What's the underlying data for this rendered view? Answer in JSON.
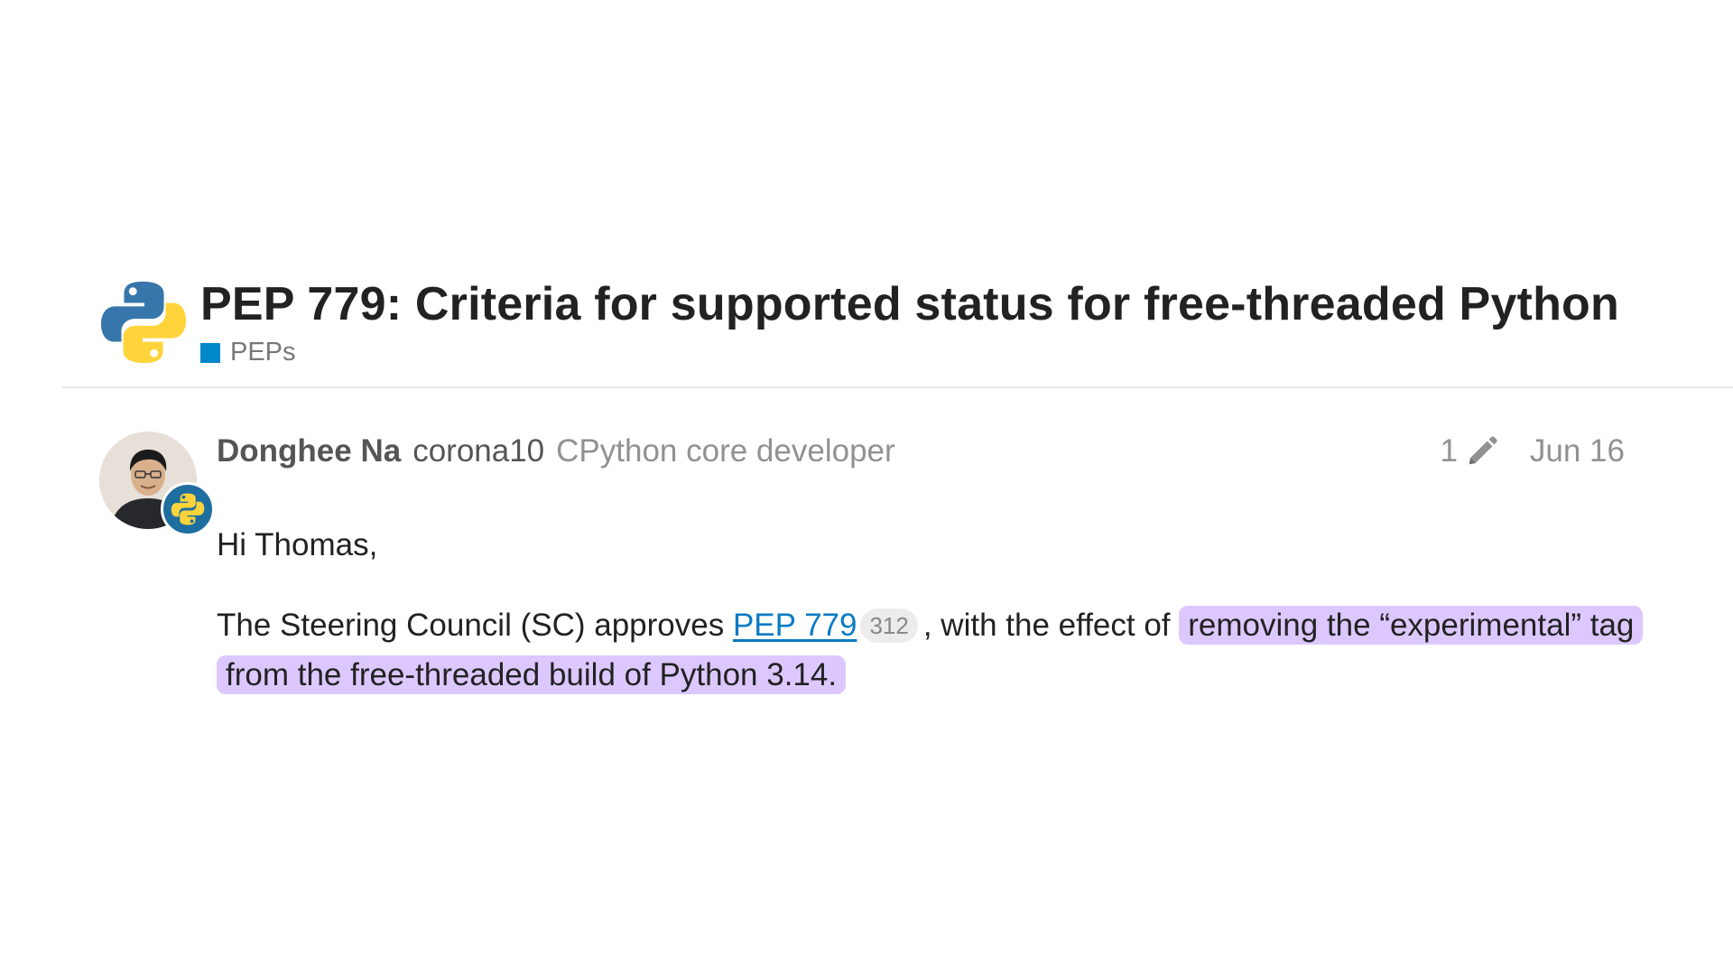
{
  "topic": {
    "title": "PEP 779: Criteria for supported status for free-threaded Python",
    "category": {
      "name": "PEPs",
      "color": "#0088cc"
    },
    "logo_icon": "python-logo-icon"
  },
  "post": {
    "author": {
      "full_name": "Donghee Na",
      "username": "corona10",
      "user_title": "CPython core developer",
      "avatar_icon": "user-avatar",
      "flair_icon": "python-flair-icon"
    },
    "edit_count": "1",
    "edit_icon": "pencil-icon",
    "date": "Jun 16",
    "body": {
      "greeting": "Hi Thomas,",
      "text_before_link": "The Steering Council (SC) approves ",
      "link_text": "PEP 779",
      "link_click_count": "312",
      "text_after_link": ", with the effect of ",
      "highlighted_text": "removing the “experimental” tag from the free-threaded build of Python 3.14.",
      "highlight_color": "#dcc8ff"
    }
  }
}
